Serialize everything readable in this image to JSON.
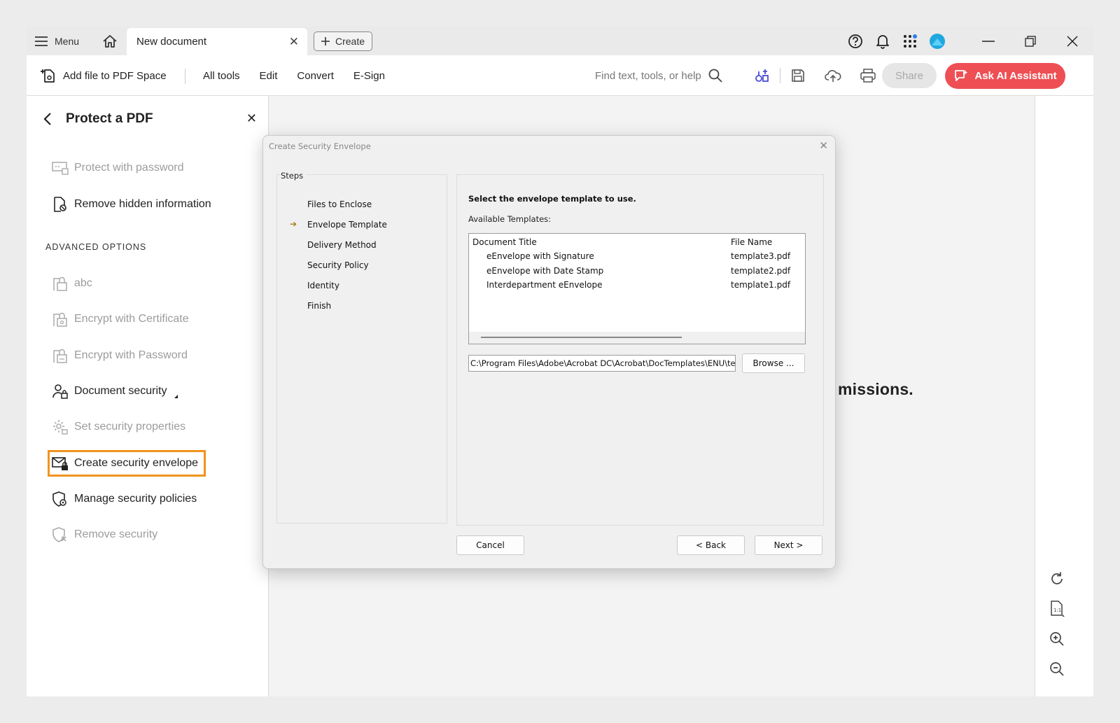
{
  "titlebar": {
    "menu_label": "Menu",
    "tab_title": "New document",
    "tab_close": "✕",
    "create_label": "Create"
  },
  "toolbar": {
    "add_file_label": "Add file to PDF Space",
    "menu_items": [
      "All tools",
      "Edit",
      "Convert",
      "E-Sign"
    ],
    "search_placeholder": "Find text, tools, or help",
    "share_label": "Share",
    "ai_label": "Ask AI Assistant"
  },
  "panel": {
    "title": "Protect a PDF",
    "close": "✕",
    "items": [
      {
        "label": "Protect with password",
        "enabled": false
      },
      {
        "label": "Remove hidden information",
        "enabled": true
      }
    ],
    "section_label": "ADVANCED OPTIONS",
    "advanced_items": [
      {
        "label": "abc",
        "enabled": false
      },
      {
        "label": "Encrypt with Certificate",
        "enabled": false
      },
      {
        "label": "Encrypt with Password",
        "enabled": false
      },
      {
        "label": "Document security",
        "enabled": true
      },
      {
        "label": "Set security properties",
        "enabled": false
      },
      {
        "label": "Create security envelope",
        "enabled": true,
        "selected": true
      },
      {
        "label": "Manage security policies",
        "enabled": true
      },
      {
        "label": "Remove security",
        "enabled": false
      }
    ]
  },
  "document": {
    "visible_text": "missions."
  },
  "dialog": {
    "title": "Create Security Envelope",
    "close": "✕",
    "steps_label": "Steps",
    "steps": [
      "Files to Enclose",
      "Envelope Template",
      "Delivery Method",
      "Security Policy",
      "Identity",
      "Finish"
    ],
    "current_step": "Envelope Template",
    "current_marker": "➔",
    "instruction": "Select the envelope template to use.",
    "available_label": "Available Templates:",
    "columns": [
      "Document Title",
      "File Name"
    ],
    "templates": [
      {
        "title": "eEnvelope with Signature",
        "file": "template3.pdf"
      },
      {
        "title": "eEnvelope with Date Stamp",
        "file": "template2.pdf"
      },
      {
        "title": "Interdepartment eEnvelope",
        "file": "template1.pdf"
      }
    ],
    "path_value": "C:\\Program Files\\Adobe\\Acrobat DC\\Acrobat\\DocTemplates\\ENU\\temp",
    "browse_label": "Browse ...",
    "cancel_label": "Cancel",
    "back_label": "< Back",
    "next_label": "Next >"
  },
  "colors": {
    "accent_ai": "#ee4f55",
    "highlight": "#f0941e",
    "step_arrow": "#a67a14"
  }
}
